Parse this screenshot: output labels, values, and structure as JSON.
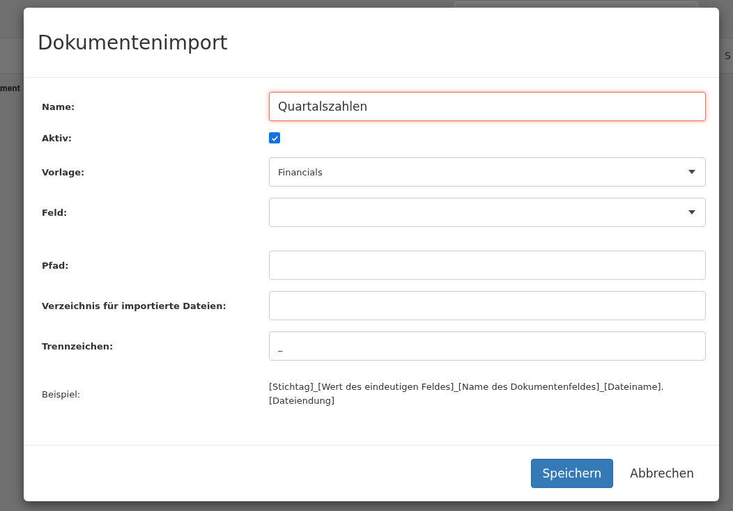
{
  "background": {
    "side_text": "ment",
    "header_text": "S"
  },
  "dialog": {
    "title": "Dokumentenimport",
    "fields": [
      {
        "kind": "text",
        "label": "Name:",
        "value": "Quartalszahlen",
        "focused": true
      },
      {
        "kind": "checkbox",
        "label": "Aktiv:",
        "checked": true
      },
      {
        "kind": "select",
        "label": "Vorlage:",
        "value": "Financials"
      },
      {
        "kind": "select",
        "label": "Feld:"
      },
      {
        "kind": "text",
        "label": "Pfad:",
        "focused": false
      },
      {
        "kind": "text",
        "label": "Verzeichnis für importierte Dateien:",
        "focused": false
      },
      {
        "kind": "text",
        "label": "Trennzeichen:",
        "value": "_",
        "focused": false
      },
      {
        "kind": "note",
        "label": "Beispiel:",
        "value": "[Stichtag]_[Wert des eindeutigen Feldes]_[Name des Dokumentenfeldes]_[Dateiname].[Dateiendung]"
      }
    ],
    "buttons": [
      {
        "label": "Speichern",
        "kind": "primary"
      },
      {
        "label": "Abbrechen",
        "kind": "link"
      }
    ]
  }
}
